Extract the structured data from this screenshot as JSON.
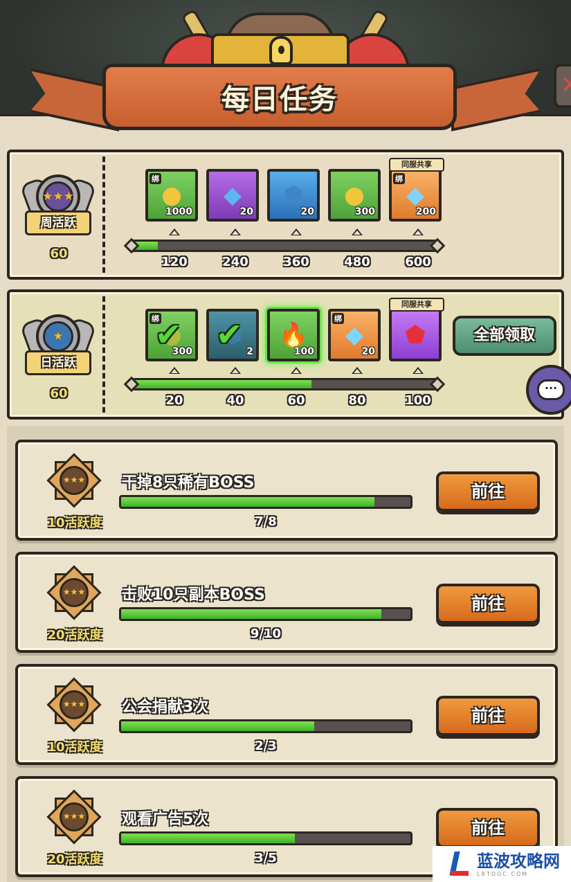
{
  "header": {
    "title": "每日任务",
    "close_symbol": "✕"
  },
  "weekly": {
    "badge_label": "周活跃",
    "badge_value": "60",
    "stars": "★★★",
    "progress": 0.08,
    "ticks": [
      "120",
      "240",
      "360",
      "480",
      "600"
    ],
    "rewards": [
      {
        "icon": "gold-coin-icon",
        "glyph": "●",
        "glyph_color": "#f3c53a",
        "amount": "1000",
        "bg": "bg-green",
        "bind": "绑",
        "share": ""
      },
      {
        "icon": "blue-ore-icon",
        "glyph": "◆",
        "glyph_color": "#5fb4f2",
        "amount": "20",
        "bg": "bg-purple",
        "bind": "",
        "share": ""
      },
      {
        "icon": "star-stone-icon",
        "glyph": "⬢",
        "glyph_color": "#3f86c9",
        "amount": "20",
        "bg": "bg-blue",
        "bind": "",
        "share": ""
      },
      {
        "icon": "gold-coin-icon",
        "glyph": "●",
        "glyph_color": "#f3c53a",
        "amount": "300",
        "bg": "bg-green",
        "bind": "",
        "share": ""
      },
      {
        "icon": "diamond-icon",
        "glyph": "◆",
        "glyph_color": "#7fd4ff",
        "amount": "200",
        "bg": "bg-orange",
        "bind": "绑",
        "share": "同服共享"
      }
    ]
  },
  "daily": {
    "badge_label": "日活跃",
    "badge_value": "60",
    "stars": "★",
    "progress": 0.59,
    "ticks": [
      "20",
      "40",
      "60",
      "80",
      "100"
    ],
    "claim_all_label": "全部领取",
    "rewards": [
      {
        "icon": "gold-coin-icon",
        "glyph": "●",
        "glyph_color": "#f3c53a",
        "amount": "300",
        "bg": "bg-green",
        "bind": "绑",
        "share": "",
        "claimed": true,
        "glow": false
      },
      {
        "icon": "star-stone-icon",
        "glyph": "⬢",
        "glyph_color": "#3f86c9",
        "amount": "2",
        "bg": "bg-teal",
        "bind": "",
        "share": "",
        "claimed": true,
        "glow": false
      },
      {
        "icon": "campfire-icon",
        "glyph": "🔥",
        "glyph_color": "#f07a22",
        "amount": "100",
        "bg": "bg-green",
        "bind": "",
        "share": "",
        "claimed": false,
        "glow": true
      },
      {
        "icon": "diamond-icon",
        "glyph": "◆",
        "glyph_color": "#7fd4ff",
        "amount": "20",
        "bg": "bg-orange",
        "bind": "绑",
        "share": "",
        "claimed": false,
        "glow": false
      },
      {
        "icon": "red-gem-icon",
        "glyph": "⬟",
        "glyph_color": "#e3303b",
        "amount": "",
        "bg": "bg-violet",
        "bind": "",
        "share": "同服共享",
        "claimed": false,
        "glow": false
      }
    ]
  },
  "chat": {
    "label": "···"
  },
  "tasks": [
    {
      "name": "干掉8只稀有BOSS",
      "points": "10活跃度",
      "count": "7/8",
      "progress": 0.875,
      "button": "前往"
    },
    {
      "name": "击败10只副本BOSS",
      "points": "20活跃度",
      "count": "9/10",
      "progress": 0.9,
      "button": "前往"
    },
    {
      "name": "公会捐献3次",
      "points": "10活跃度",
      "count": "2/3",
      "progress": 0.667,
      "button": "前往"
    },
    {
      "name": "观看广告5次",
      "points": "20活跃度",
      "count": "3/5",
      "progress": 0.6,
      "button": "前往"
    }
  ],
  "watermark": {
    "brand": "蓝波攻略网",
    "url": "LBTDOC.COM"
  }
}
